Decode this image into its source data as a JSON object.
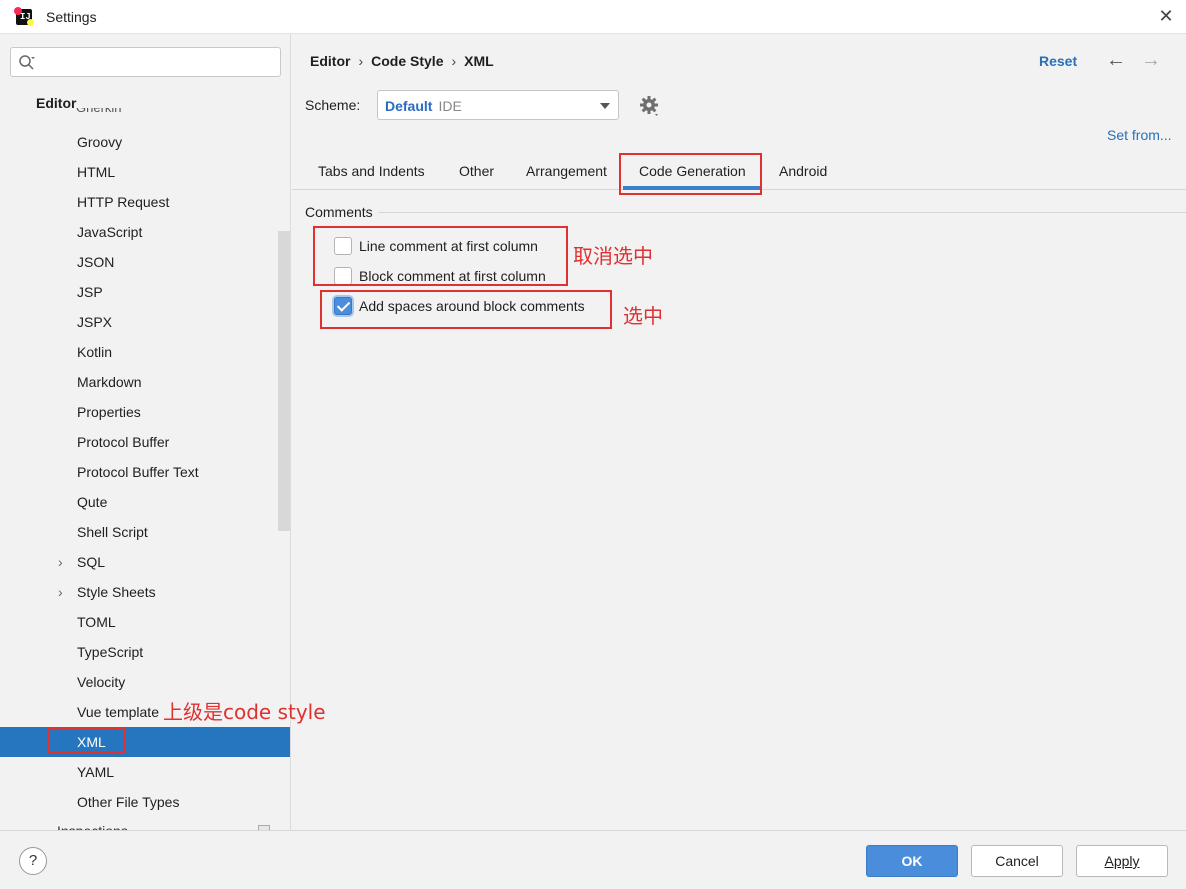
{
  "window": {
    "title": "Settings",
    "close_symbol": "✕",
    "app_icon": "intellij-idea-icon"
  },
  "sidebar": {
    "search": {
      "value": "",
      "placeholder": ""
    },
    "section_header": "Editor",
    "clipped_top_item": "Gherkin",
    "items": [
      {
        "label": "Groovy"
      },
      {
        "label": "HTML"
      },
      {
        "label": "HTTP Request"
      },
      {
        "label": "JavaScript"
      },
      {
        "label": "JSON"
      },
      {
        "label": "JSP"
      },
      {
        "label": "JSPX"
      },
      {
        "label": "Kotlin"
      },
      {
        "label": "Markdown"
      },
      {
        "label": "Properties"
      },
      {
        "label": "Protocol Buffer"
      },
      {
        "label": "Protocol Buffer Text"
      },
      {
        "label": "Qute"
      },
      {
        "label": "Shell Script"
      },
      {
        "label": "SQL",
        "expandable": true
      },
      {
        "label": "Style Sheets",
        "expandable": true
      },
      {
        "label": "TOML"
      },
      {
        "label": "TypeScript"
      },
      {
        "label": "Velocity"
      },
      {
        "label": "Vue template"
      },
      {
        "label": "XML",
        "selected": true
      },
      {
        "label": "YAML"
      },
      {
        "label": "Other File Types"
      }
    ],
    "clipped_bottom_item": "Inspections",
    "selected_color": "#2675bf"
  },
  "header": {
    "breadcrumb": [
      "Editor",
      "Code Style",
      "XML"
    ],
    "breadcrumb_sep": "›",
    "reset_label": "Reset",
    "back_symbol": "←",
    "forward_symbol": "→"
  },
  "scheme": {
    "label": "Scheme:",
    "name": "Default",
    "type": "IDE"
  },
  "set_from_label": "Set from...",
  "tabs": [
    {
      "label": "Tabs and Indents"
    },
    {
      "label": "Other"
    },
    {
      "label": "Arrangement"
    },
    {
      "label": "Code Generation",
      "active": true
    },
    {
      "label": "Android"
    }
  ],
  "comments_section": {
    "title": "Comments",
    "options": [
      {
        "label": "Line comment at first column",
        "checked": false
      },
      {
        "label": "Block comment at first column",
        "checked": false
      },
      {
        "label": "Add spaces around block comments",
        "checked": true
      }
    ]
  },
  "annotations": {
    "uncheck": "取消选中",
    "check": "选中",
    "parent": "上级是code style",
    "color": "#e03131"
  },
  "footer": {
    "help": "?",
    "ok": "OK",
    "cancel": "Cancel",
    "apply": "Apply"
  }
}
